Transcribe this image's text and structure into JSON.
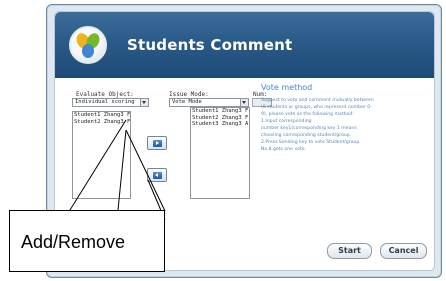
{
  "window": {
    "title": "Students Comment"
  },
  "icons": {
    "logo": "students-logo-icon"
  },
  "labels": {
    "evaluate_object": "Evaluate Object:",
    "issue_mode": "Issue Mode:",
    "num": "Num:"
  },
  "evaluate_object_select": {
    "value": "Individual scoring"
  },
  "issue_mode_select": {
    "value": "Vote Mode"
  },
  "left_list": {
    "rows": [
      "Student1 Zhang3 F",
      "Student2 Zhang3 F"
    ]
  },
  "right_list": {
    "rows": [
      "Student1 Zhang3 F",
      "Student2 Zhang3 F",
      "Student3 Zhang3 A"
    ]
  },
  "vote_panel": {
    "title": "Vote method",
    "lines": [
      "Suggest to vote and comment mutually between",
      "(8 students or groups, who represent number 0-",
      "9), please vote as the following method:",
      "  1.Input corresponding",
      "number key1(corresponding key 1 means",
      "choosing corresponding student/group.",
      "  2.Press Sending key to vote Student/group",
      "No.8 gets one vote."
    ]
  },
  "buttons": {
    "start": "Start",
    "cancel": "Cancel"
  },
  "callout": {
    "text": "Add/Remove"
  }
}
